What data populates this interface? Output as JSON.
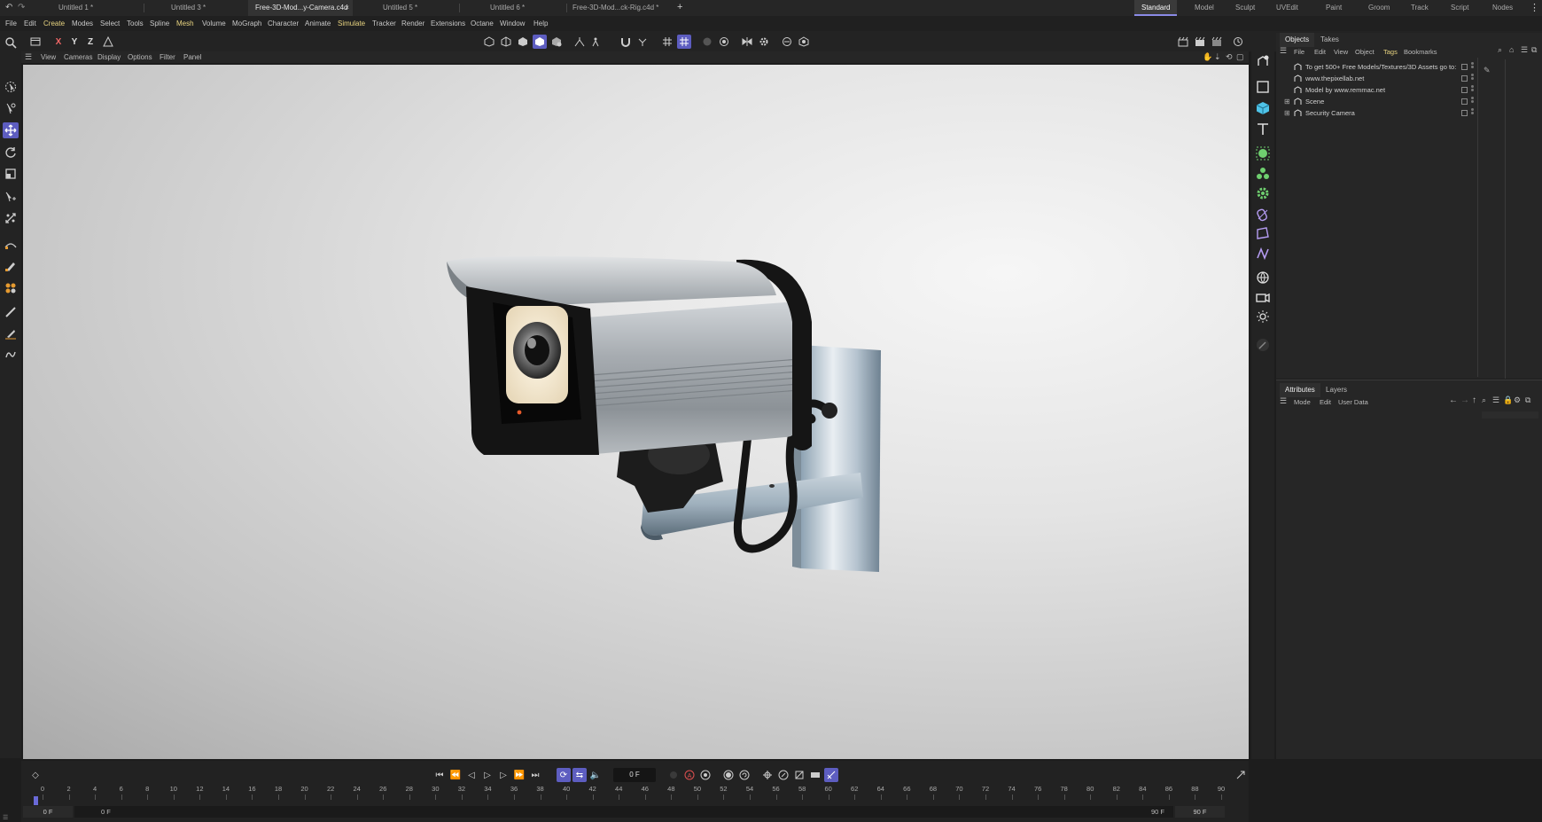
{
  "doc_tabs": [
    {
      "label": "Untitled 1 *"
    },
    {
      "label": "Untitled 3 *"
    },
    {
      "label": "Free-3D-Mod...y-Camera.c4d",
      "active": true
    },
    {
      "label": "Untitled 5 *"
    },
    {
      "label": "Untitled 6 *"
    },
    {
      "label": "Free-3D-Mod...ck-Rig.c4d *"
    }
  ],
  "new_tab_label": "+",
  "close_tab_label": "×",
  "layouts": [
    "Standard",
    "Model",
    "Sculpt",
    "UVEdit",
    "Paint",
    "Groom",
    "Track",
    "Script",
    "Nodes"
  ],
  "active_layout": "Standard",
  "menu": [
    "File",
    "Edit",
    "Create",
    "Modes",
    "Select",
    "Tools",
    "Spline",
    "Mesh",
    "Volume",
    "MoGraph",
    "Character",
    "Animate",
    "Simulate",
    "Tracker",
    "Render",
    "Extensions",
    "Octane",
    "Window",
    "Help"
  ],
  "axis_labels": [
    "X",
    "Y",
    "Z"
  ],
  "viewport_menu": [
    "View",
    "Cameras",
    "Display",
    "Options",
    "Filter",
    "Panel"
  ],
  "objects_panel": {
    "tabs": [
      "Objects",
      "Takes"
    ],
    "menu": [
      "File",
      "Edit",
      "View",
      "Object",
      "Tags",
      "Bookmarks"
    ],
    "rows": [
      {
        "name": "To get 500+ Free Models/Textures/3D Assets go to:",
        "expandable": false
      },
      {
        "name": "www.thepixellab.net",
        "expandable": false
      },
      {
        "name": "Model by www.remmac.net",
        "expandable": false
      },
      {
        "name": "Scene",
        "expandable": true
      },
      {
        "name": "Security Camera",
        "expandable": true
      }
    ]
  },
  "attributes_panel": {
    "tabs": [
      "Attributes",
      "Layers"
    ],
    "menu": [
      "Mode",
      "Edit",
      "User Data"
    ]
  },
  "timeline": {
    "current_frame": "0 F",
    "start_frame": "0 F",
    "start_frame_2": "0 F",
    "end_frame": "90 F",
    "end_frame_2": "90 F",
    "ticks": [
      0,
      2,
      4,
      6,
      8,
      10,
      12,
      14,
      16,
      18,
      20,
      22,
      24,
      26,
      28,
      30,
      32,
      34,
      36,
      38,
      40,
      42,
      44,
      46,
      48,
      50,
      52,
      54,
      56,
      58,
      60,
      62,
      64,
      66,
      68,
      70,
      72,
      74,
      76,
      78,
      80,
      82,
      84,
      86,
      88,
      90
    ]
  },
  "colors": {
    "accent": "#5d5dc0",
    "menu_highlight": "#e8d480",
    "green_icon": "#6fcf6f",
    "cyan_icon": "#4ec3e8",
    "purple_icon": "#b59cf2"
  }
}
